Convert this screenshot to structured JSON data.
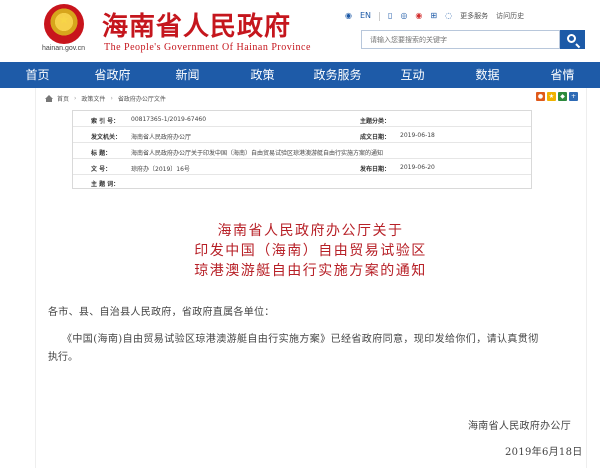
{
  "header": {
    "site_domain": "hainan.gov.cn",
    "title": "海南省人民政府",
    "subtitle": "The People's Government Of Hainan Province",
    "tools": {
      "en": "EN",
      "more_services": "更多服务",
      "visit_history": "访问历史"
    },
    "search_placeholder": "请输入您要搜索的关键字"
  },
  "nav": [
    "首页",
    "省政府",
    "新闻",
    "政策",
    "政务服务",
    "互动",
    "数据",
    "省情"
  ],
  "breadcrumb": [
    "首页",
    "政策文件",
    "省政府办公厅文件"
  ],
  "meta": {
    "labels": {
      "index_no": "索 引 号：",
      "issuer": "发文机关：",
      "subject": "标 题：",
      "doc_no": "文 号：",
      "theme_word": "主 题 词：",
      "category": "主题分类：",
      "date_written": "成文日期：",
      "date_published": "发布日期："
    },
    "values": {
      "index_no": "00817365-1/2019-67460",
      "issuer": "海南省人民政府办公厅",
      "subject": "海南省人民政府办公厅关于印发中国（海南）自由贸易试验区琼港澳游艇自由行实施方案的通知",
      "doc_no": "琼府办〔2019〕16号",
      "date_written": "2019-06-18",
      "date_published": "2019-06-20"
    }
  },
  "document": {
    "title_lines": [
      "海南省人民政府办公厅关于",
      "印发中国（海南）自由贸易试验区",
      "琼港澳游艇自由行实施方案的通知"
    ],
    "salutation": "各市、县、自治县人民政府，省政府直属各单位：",
    "body": "《中国(海南)自由贸易试验区琼港澳游艇自由行实施方案》已经省政府同意，现印发给你们，请认真贯彻",
    "body_cont": "执行。",
    "signature": "海南省人民政府办公厅",
    "date": "2019年6月18日"
  },
  "colors": {
    "brand_red": "#c5161d",
    "nav_blue": "#1e5ba8",
    "title_red": "#b72027"
  },
  "icons": [
    "home-icon",
    "search-icon",
    "weibo-icon",
    "wechat-icon",
    "mobile-icon",
    "accessibility-icon",
    "user-icon"
  ]
}
